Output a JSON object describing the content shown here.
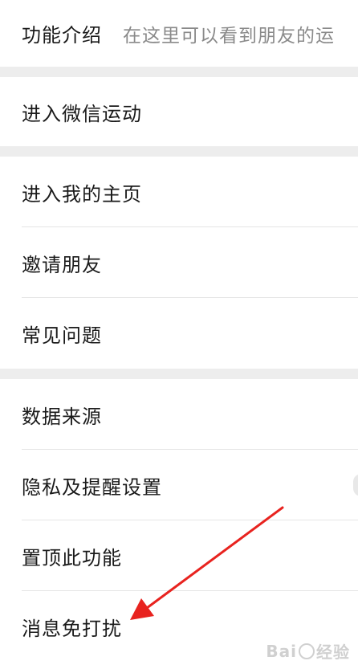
{
  "intro": {
    "label": "功能介绍",
    "description": "在这里可以看到朋友的运"
  },
  "sport": {
    "label": "进入微信运动"
  },
  "home_group": [
    {
      "label": "进入我的主页"
    },
    {
      "label": "邀请朋友"
    },
    {
      "label": "常见问题"
    }
  ],
  "data_group": [
    {
      "label": "数据来源"
    },
    {
      "label": "隐私及提醒设置"
    },
    {
      "label": "置顶此功能"
    },
    {
      "label": "消息免打扰"
    }
  ],
  "annotation": {
    "arrow_color": "#e8231f"
  },
  "watermark": {
    "text_left": "Bai",
    "text_right": "经验"
  }
}
